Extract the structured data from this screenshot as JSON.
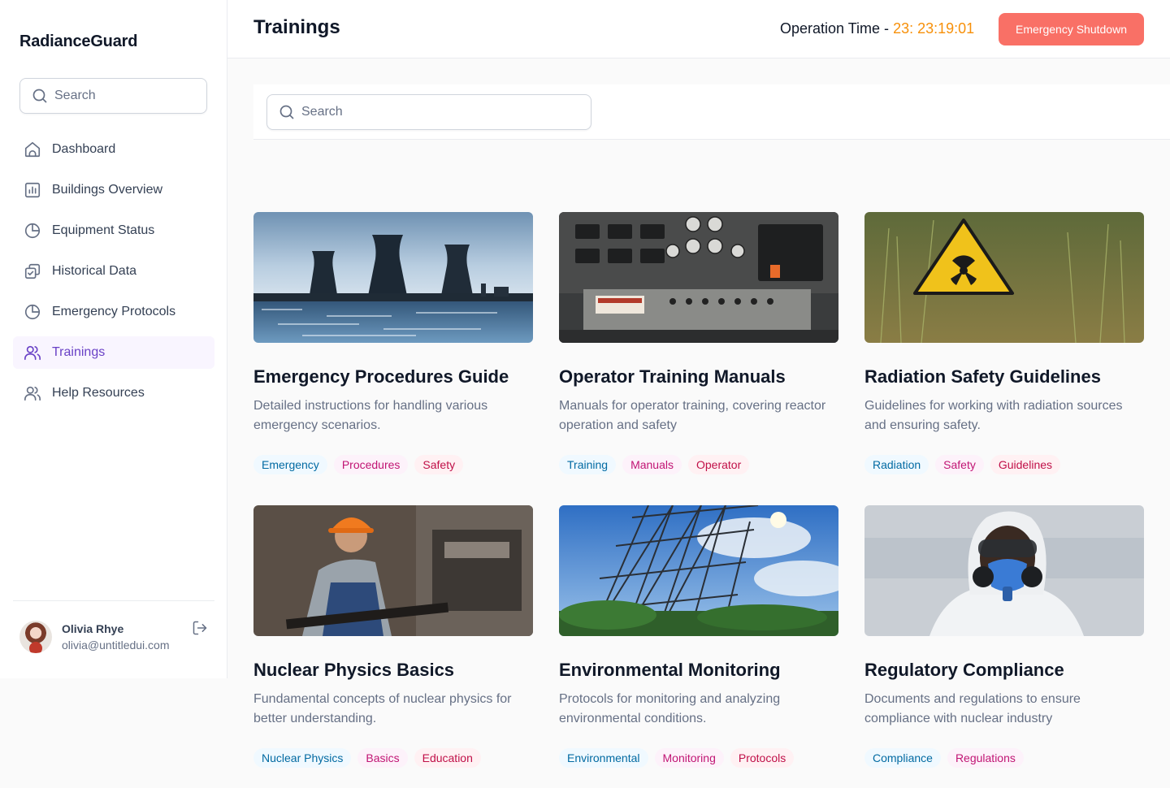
{
  "sidebar": {
    "brand": "RadianceGuard",
    "search_placeholder": "Search",
    "items": [
      {
        "label": "Dashboard"
      },
      {
        "label": "Buildings Overview"
      },
      {
        "label": "Equipment Status"
      },
      {
        "label": "Historical Data"
      },
      {
        "label": "Emergency Protocols"
      },
      {
        "label": "Trainings"
      },
      {
        "label": "Help Resources"
      }
    ],
    "active_index": 5,
    "user": {
      "name": "Olivia Rhye",
      "email": "olivia@untitledui.com"
    }
  },
  "header": {
    "title": "Trainings",
    "operation_label": "Operation Time - ",
    "operation_time": "23: 23:19:01",
    "shutdown_label": "Emergency Shutdown"
  },
  "main": {
    "search_placeholder": "Search",
    "cards": [
      {
        "title": "Emergency Procedures Guide",
        "description": "Detailed instructions for handling various emergency scenarios.",
        "tags": [
          "Emergency",
          "Procedures",
          "Safety"
        ],
        "image": "cooling-towers"
      },
      {
        "title": "Operator Training Manuals",
        "description": "Manuals for operator training, covering reactor operation and safety",
        "tags": [
          "Training",
          "Manuals",
          "Operator"
        ],
        "image": "control-panel"
      },
      {
        "title": "Radiation Safety Guidelines",
        "description": "Guidelines for working with radiation sources and ensuring safety.",
        "tags": [
          "Radiation",
          "Safety",
          "Guidelines"
        ],
        "image": "radiation-sign"
      },
      {
        "title": "Nuclear Physics Basics",
        "description": "Fundamental concepts of nuclear physics for better understanding.",
        "tags": [
          "Nuclear Physics",
          "Basics",
          "Education"
        ],
        "image": "worker"
      },
      {
        "title": "Environmental Monitoring",
        "description": "Protocols for monitoring and analyzing environmental conditions.",
        "tags": [
          "Environmental",
          "Monitoring",
          "Protocols"
        ],
        "image": "radar-tower"
      },
      {
        "title": "Regulatory Compliance",
        "description": "Documents and regulations to ensure compliance with nuclear industry",
        "tags": [
          "Compliance",
          "Regulations"
        ],
        "image": "hazmat-suit"
      }
    ]
  },
  "colors": {
    "accent": "#6941c6",
    "shutdown": "#f97066",
    "time": "#f79009"
  }
}
